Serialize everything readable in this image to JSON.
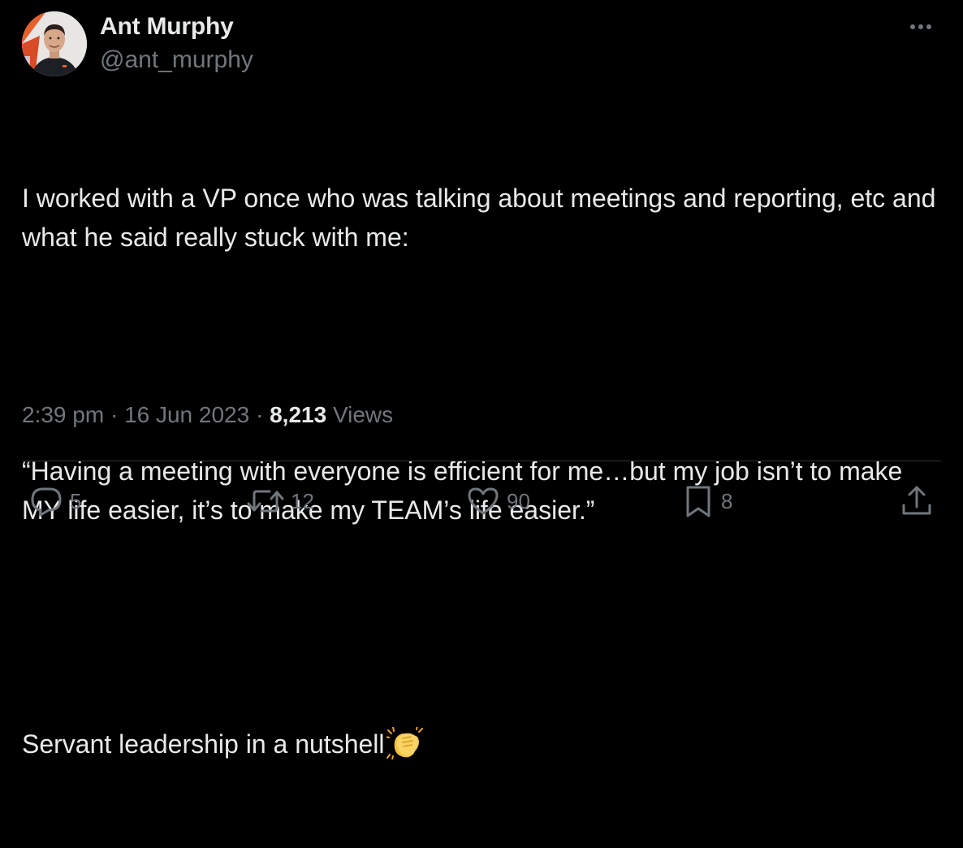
{
  "author": {
    "display_name": "Ant Murphy",
    "handle": "@ant_murphy",
    "avatar": "avatar-photo"
  },
  "tweet": {
    "line1": "I worked with a VP once who was talking about meetings and reporting, etc and what he said really stuck with me:",
    "line2": "“Having a meeting with everyone is efficient for me…but my job isn’t to make MY life easier, it’s to make my TEAM’s life easier.”",
    "line3": "Servant leadership in a nutshell",
    "emoji": "clapping-hands-icon"
  },
  "meta": {
    "time": "2:39 pm",
    "separator": "·",
    "date": "16 Jun 2023",
    "views_count": "8,213",
    "views_label": "Views"
  },
  "actions": {
    "replies": "5",
    "reposts": "12",
    "likes": "90",
    "bookmarks": "8"
  },
  "icons": {
    "more": "more-dots-icon",
    "reply": "reply-bubble-icon",
    "repost": "repost-arrows-icon",
    "like": "heart-icon",
    "bookmark": "bookmark-icon",
    "share": "share-upload-icon"
  },
  "colors": {
    "background": "#000000",
    "text_primary": "#e7e9ea",
    "text_secondary": "#71767b",
    "divider": "#2f3336"
  }
}
